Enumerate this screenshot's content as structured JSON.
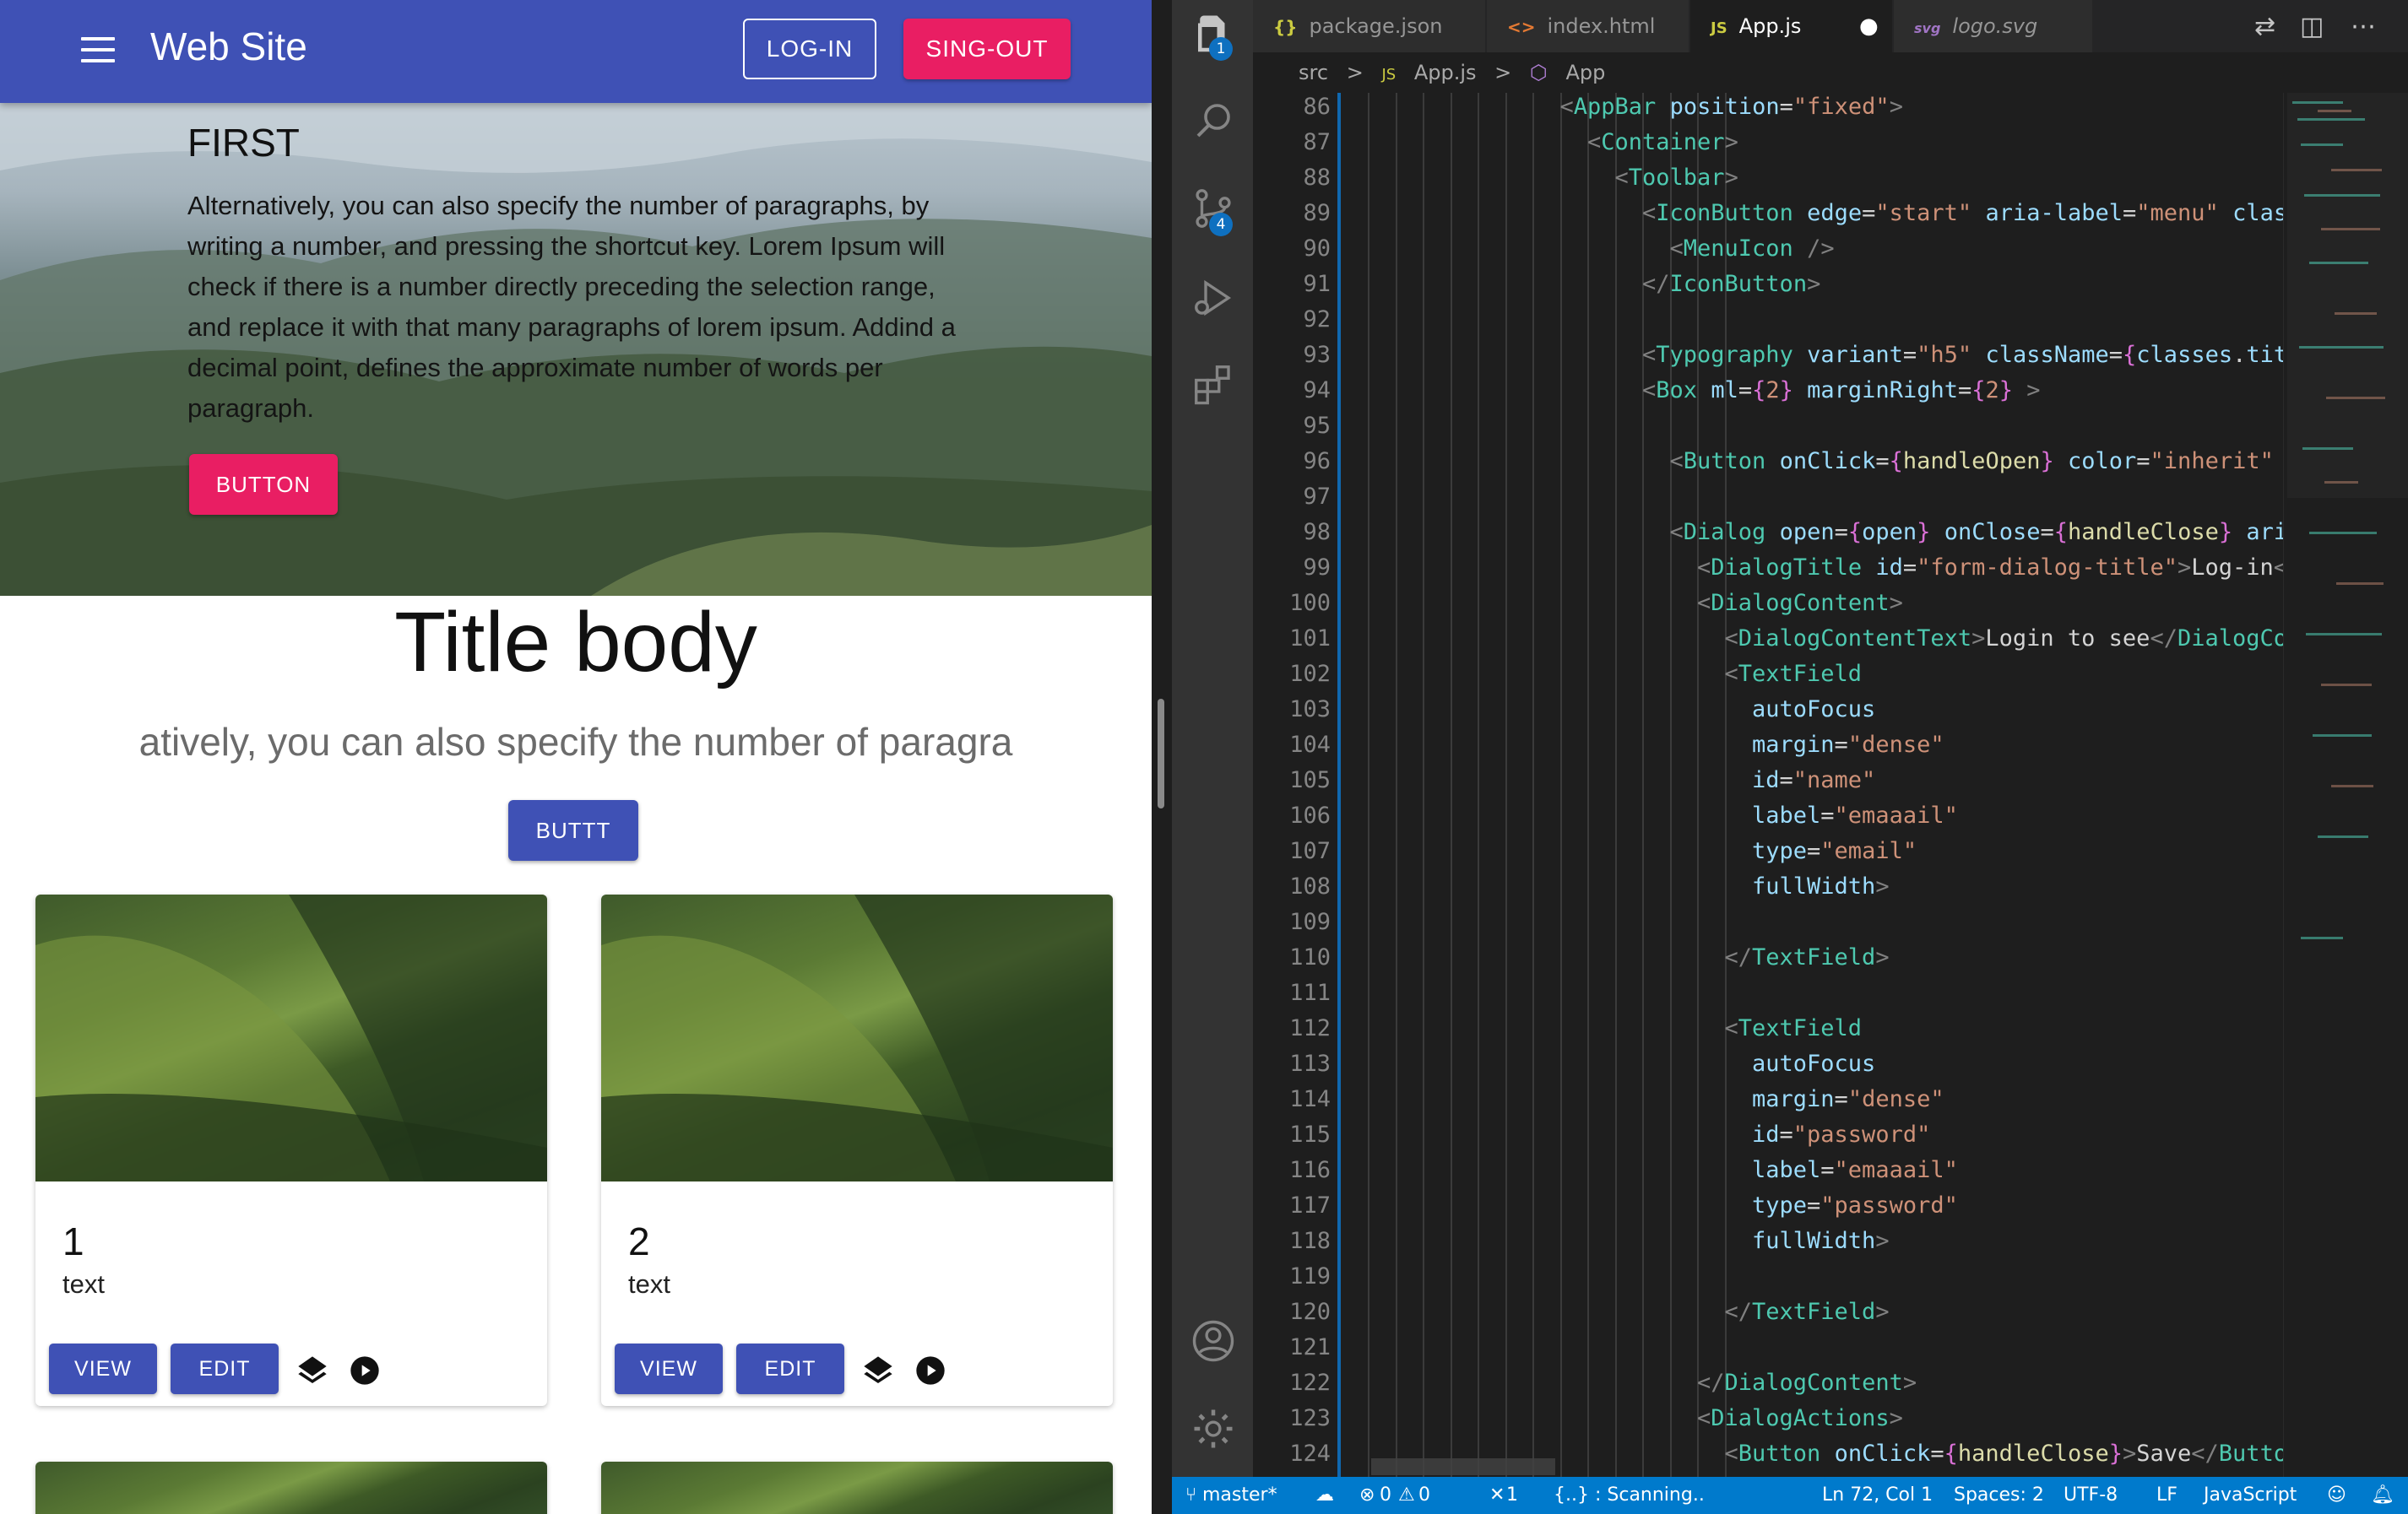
{
  "browser": {
    "appbar": {
      "title": "Web Site",
      "login_label": "LOG-IN",
      "signout_label": "SING-OUT",
      "menu_icon": "menu-icon",
      "color": "#3f51b5",
      "accent": "#e91e63"
    },
    "hero": {
      "title": "FIRST",
      "text": "Alternatively, you can also specify the number of paragraphs, by writing a number, and pressing the shortcut key. Lorem Ipsum will check if there is a number directly preceding the selection range, and replace it with that many paragraphs of lorem ipsum. Addind a decimal point, defines the approximate number of words per paragraph.",
      "button_label": "BUTTON"
    },
    "body": {
      "title": "Title body",
      "subtitle": "atively, you can also specify the number of paragra",
      "button_label": "BUTTT"
    },
    "cards": [
      {
        "number": "1",
        "text": "text",
        "view_label": "VIEW",
        "edit_label": "EDIT"
      },
      {
        "number": "2",
        "text": "text",
        "view_label": "VIEW",
        "edit_label": "EDIT"
      }
    ]
  },
  "vscode": {
    "activity_badges": {
      "explorer": "1",
      "source_control": "4"
    },
    "tabs": [
      {
        "icon": "{}",
        "label": "package.json",
        "active": false
      },
      {
        "icon": "<>",
        "label": "index.html",
        "active": false
      },
      {
        "icon": "JS",
        "label": "App.js",
        "active": true,
        "modified": true
      },
      {
        "icon": "svg",
        "label": "logo.svg",
        "active": false
      }
    ],
    "breadcrumb": [
      "src",
      ">",
      "JS",
      "App.js",
      ">",
      "App"
    ],
    "lines": [
      {
        "n": "86",
        "indent": 7,
        "html": "<span class=t-brk>&lt;</span><span class=t-tag>AppBar</span> <span class=t-attr>position</span>=<span class=t-str>\"fixed\"</span><span class=t-brk>&gt;</span>"
      },
      {
        "n": "87",
        "indent": 8,
        "html": "<span class=t-brk>&lt;</span><span class=t-tag>Container</span><span class=t-brk>&gt;</span>"
      },
      {
        "n": "88",
        "indent": 9,
        "html": "<span class=t-brk>&lt;</span><span class=t-tag>Toolbar</span><span class=t-brk>&gt;</span>"
      },
      {
        "n": "89",
        "indent": 10,
        "html": "<span class=t-brk>&lt;</span><span class=t-tag>IconButton</span> <span class=t-attr>edge</span>=<span class=t-str>\"start\"</span> <span class=t-attr>aria-label</span>=<span class=t-str>\"menu\"</span> <span class=t-attr>className</span>"
      },
      {
        "n": "90",
        "indent": 11,
        "html": "<span class=t-brk>&lt;</span><span class=t-tag>MenuIcon</span> <span class=t-brk>/&gt;</span>"
      },
      {
        "n": "91",
        "indent": 10,
        "html": "<span class=t-brk>&lt;/</span><span class=t-tag>IconButton</span><span class=t-brk>&gt;</span>"
      },
      {
        "n": "92",
        "indent": 0,
        "html": ""
      },
      {
        "n": "93",
        "indent": 10,
        "html": "<span class=t-brk>&lt;</span><span class=t-tag>Typography</span> <span class=t-attr>variant</span>=<span class=t-str>\"h5\"</span> <span class=t-attr>className</span>=<span class=t-br>{</span><span class=t-var>classes</span>.<span class=t-var>title</span><span class=t-br>}</span> <span class=t-brk>&gt;</span>"
      },
      {
        "n": "94",
        "indent": 10,
        "html": "<span class=t-brk>&lt;</span><span class=t-tag>Box</span> <span class=t-attr>ml</span>=<span class=t-br>{</span><span class=t-str>2</span><span class=t-br>}</span> <span class=t-attr>marginRight</span>=<span class=t-br>{</span><span class=t-str>2</span><span class=t-br>}</span> <span class=t-brk>&gt;</span>"
      },
      {
        "n": "95",
        "indent": 0,
        "html": ""
      },
      {
        "n": "96",
        "indent": 11,
        "html": "<span class=t-brk>&lt;</span><span class=t-tag>Button</span> <span class=t-attr>onClick</span>=<span class=t-br>{</span><span class=t-fn>handleOpen</span><span class=t-br>}</span> <span class=t-attr>color</span>=<span class=t-str>\"inherit\"</span> <span class=t-attr>varia</span>"
      },
      {
        "n": "97",
        "indent": 0,
        "html": ""
      },
      {
        "n": "98",
        "indent": 11,
        "html": "<span class=t-brk>&lt;</span><span class=t-tag>Dialog</span> <span class=t-attr>open</span>=<span class=t-br>{</span><span class=t-var>open</span><span class=t-br>}</span> <span class=t-attr>onClose</span>=<span class=t-br>{</span><span class=t-fn>handleClose</span><span class=t-br>}</span> <span class=t-attr>aria-lab</span>"
      },
      {
        "n": "99",
        "indent": 12,
        "html": "<span class=t-brk>&lt;</span><span class=t-tag>DialogTitle</span> <span class=t-attr>id</span>=<span class=t-str>\"form-dialog-title\"</span><span class=t-brk>&gt;</span><span class=t-txt>Log-in</span><span class=t-brk>&lt;/</span><span class=t-tag>Dial</span>"
      },
      {
        "n": "100",
        "indent": 12,
        "html": "<span class=t-brk>&lt;</span><span class=t-tag>DialogContent</span><span class=t-brk>&gt;</span>"
      },
      {
        "n": "101",
        "indent": 13,
        "html": "<span class=t-brk>&lt;</span><span class=t-tag>DialogContentText</span><span class=t-brk>&gt;</span><span class=t-txt>Login to see</span><span class=t-brk>&lt;/</span><span class=t-tag>DialogContent</span>"
      },
      {
        "n": "102",
        "indent": 13,
        "html": "<span class=t-brk>&lt;</span><span class=t-tag>TextField</span>"
      },
      {
        "n": "103",
        "indent": 14,
        "html": "<span class=t-attr>autoFocus</span>"
      },
      {
        "n": "104",
        "indent": 14,
        "html": "<span class=t-attr>margin</span>=<span class=t-str>\"dense\"</span>"
      },
      {
        "n": "105",
        "indent": 14,
        "html": "<span class=t-attr>id</span>=<span class=t-str>\"name\"</span>"
      },
      {
        "n": "106",
        "indent": 14,
        "html": "<span class=t-attr>label</span>=<span class=t-str>\"emaaail\"</span>"
      },
      {
        "n": "107",
        "indent": 14,
        "html": "<span class=t-attr>type</span>=<span class=t-str>\"email\"</span>"
      },
      {
        "n": "108",
        "indent": 14,
        "html": "<span class=t-attr>fullWidth</span><span class=t-brk>&gt;</span>"
      },
      {
        "n": "109",
        "indent": 0,
        "html": ""
      },
      {
        "n": "110",
        "indent": 13,
        "html": "<span class=t-brk>&lt;/</span><span class=t-tag>TextField</span><span class=t-brk>&gt;</span>"
      },
      {
        "n": "111",
        "indent": 0,
        "html": ""
      },
      {
        "n": "112",
        "indent": 13,
        "html": "<span class=t-brk>&lt;</span><span class=t-tag>TextField</span>"
      },
      {
        "n": "113",
        "indent": 14,
        "html": "<span class=t-attr>autoFocus</span>"
      },
      {
        "n": "114",
        "indent": 14,
        "html": "<span class=t-attr>margin</span>=<span class=t-str>\"dense\"</span>"
      },
      {
        "n": "115",
        "indent": 14,
        "html": "<span class=t-attr>id</span>=<span class=t-str>\"password\"</span>"
      },
      {
        "n": "116",
        "indent": 14,
        "html": "<span class=t-attr>label</span>=<span class=t-str>\"emaaail\"</span>"
      },
      {
        "n": "117",
        "indent": 14,
        "html": "<span class=t-attr>type</span>=<span class=t-str>\"password\"</span>"
      },
      {
        "n": "118",
        "indent": 14,
        "html": "<span class=t-attr>fullWidth</span><span class=t-brk>&gt;</span>"
      },
      {
        "n": "119",
        "indent": 0,
        "html": ""
      },
      {
        "n": "120",
        "indent": 13,
        "html": "<span class=t-brk>&lt;/</span><span class=t-tag>TextField</span><span class=t-brk>&gt;</span>"
      },
      {
        "n": "121",
        "indent": 0,
        "html": ""
      },
      {
        "n": "122",
        "indent": 12,
        "html": "<span class=t-brk>&lt;/</span><span class=t-tag>DialogContent</span><span class=t-brk>&gt;</span>"
      },
      {
        "n": "123",
        "indent": 12,
        "html": "<span class=t-brk>&lt;</span><span class=t-tag>DialogActions</span><span class=t-brk>&gt;</span>"
      },
      {
        "n": "124",
        "indent": 13,
        "html": "<span class=t-brk>&lt;</span><span class=t-tag>Button</span> <span class=t-attr>onClick</span>=<span class=t-br>{</span><span class=t-fn>handleClose</span><span class=t-br>}</span><span class=t-brk>&gt;</span><span class=t-txt>Save</span><span class=t-brk>&lt;/</span><span class=t-tag>Button</span><span class=t-brk>&gt;</span>"
      }
    ],
    "statusbar": {
      "branch": "master*",
      "errors": "0",
      "warnings": "0",
      "ports": "1",
      "scanning": "{..} : Scanning..",
      "position": "Ln 72, Col 1",
      "spaces": "Spaces: 2",
      "encoding": "UTF-8",
      "eol": "LF",
      "language": "JavaScript",
      "color": "#007acc"
    }
  }
}
